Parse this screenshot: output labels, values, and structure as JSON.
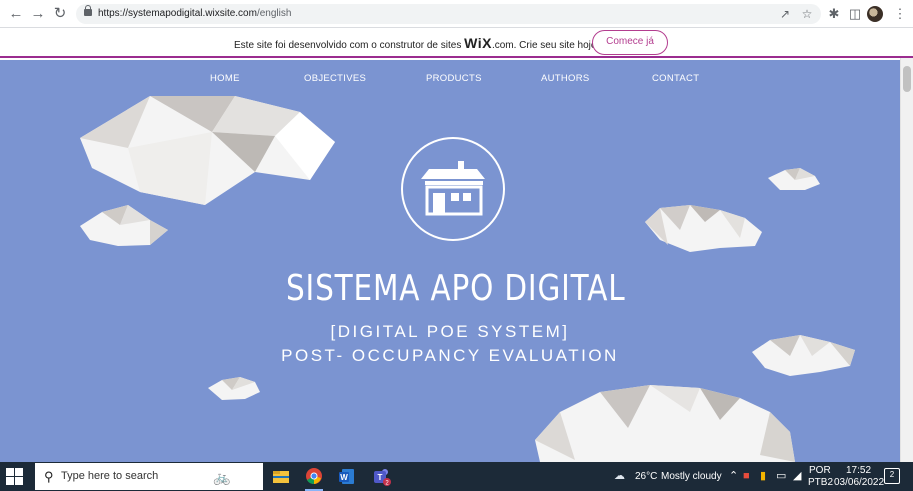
{
  "browser": {
    "url_host": "https://systemapodigital.wixsite.com",
    "url_path": "/english",
    "back_icon": "arrow-left-icon",
    "forward_icon": "arrow-right-icon",
    "reload_icon": "reload-icon"
  },
  "wix_banner": {
    "text_before": "Este site foi desenvolvido com o construtor de sites",
    "logo": "WiX",
    "text_after": ".com. Crie seu site hoje.",
    "cta": "Comece já"
  },
  "menu": [
    {
      "label": "HOME"
    },
    {
      "label": "OBJECTIVES"
    },
    {
      "label": "PRODUCTS"
    },
    {
      "label": "AUTHORS"
    },
    {
      "label": "CONTACT"
    }
  ],
  "hero": {
    "title": "SISTEMA APO DIGITAL",
    "subtitle1": "[DIGITAL POE SYSTEM]",
    "subtitle2": "POST- OCCUPANCY EVALUATION",
    "logo_icon": "house-icon"
  },
  "colors": {
    "hero_bg": "#7b94d1",
    "wix_accent": "#b33d8f",
    "taskbar": "#1c2a38"
  },
  "taskbar": {
    "search_placeholder": "Type here to search",
    "weather_temp": "26°C",
    "weather_text": "Mostly cloudy",
    "language": "POR",
    "keyboard": "PTB2",
    "time": "17:52",
    "date": "03/06/2022",
    "teams_badge": "2",
    "notification_count": "2"
  }
}
